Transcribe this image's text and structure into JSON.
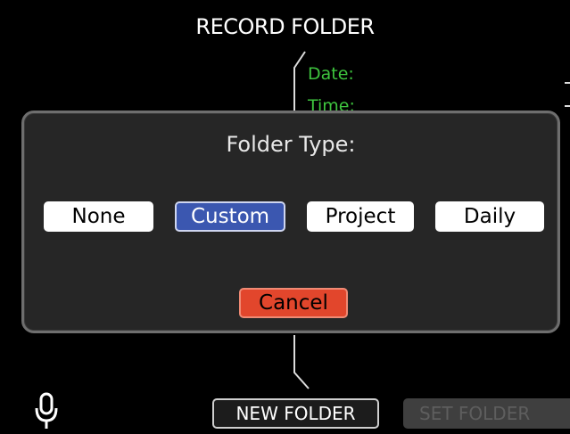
{
  "screen": {
    "title": "RECORD FOLDER",
    "date_label": "Date:",
    "time_label": "Time:"
  },
  "dialog": {
    "title": "Folder Type:",
    "options": [
      {
        "label": "None",
        "selected": false
      },
      {
        "label": "Custom",
        "selected": true
      },
      {
        "label": "Project",
        "selected": false
      },
      {
        "label": "Daily",
        "selected": false
      }
    ],
    "cancel_label": "Cancel"
  },
  "bottom_bar": {
    "mic_icon": "microphone-icon",
    "new_folder_label": "NEW FOLDER",
    "set_folder_label": "SET FOLDER",
    "set_folder_enabled": false
  },
  "colors": {
    "accent_green": "#3ec43e",
    "selected_blue": "#3b57b0",
    "cancel_red": "#e2462c",
    "background": "#000000"
  }
}
